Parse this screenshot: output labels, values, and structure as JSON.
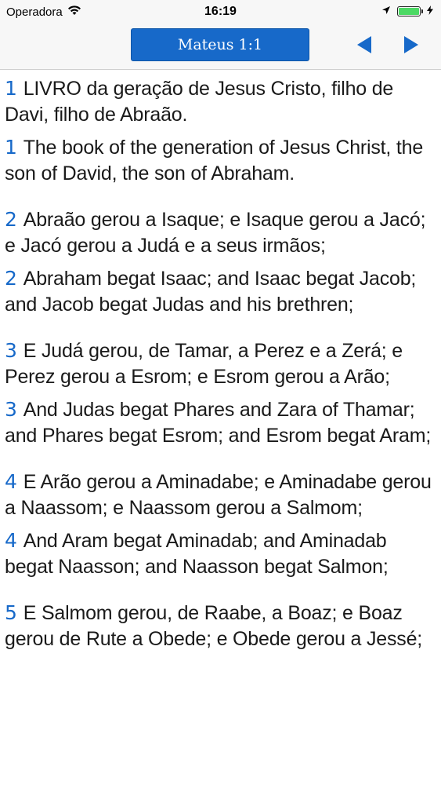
{
  "status_bar": {
    "carrier": "Operadora",
    "time": "16:19",
    "battery_level": 1.0,
    "battery_color": "#4cd964"
  },
  "nav": {
    "reference": "Mateus 1:1",
    "accent_color": "#1769c9",
    "prev_icon": "left-triangle-icon",
    "next_icon": "right-triangle-icon"
  },
  "verses": [
    {
      "pt_number": "1",
      "pt_text": "LIVRO da geração de Jesus Cristo, filho de Davi, filho de Abraão.",
      "en_number": "1",
      "en_text": "The book of the generation of Jesus Christ, the son of David, the son of Abraham."
    },
    {
      "pt_number": "2",
      "pt_text": "Abraão gerou a Isaque; e Isaque gerou a Jacó; e Jacó gerou a Judá e a seus irmãos;",
      "en_number": "2",
      "en_text": "Abraham begat Isaac; and Isaac begat Jacob; and Jacob begat Judas and his brethren;"
    },
    {
      "pt_number": "3",
      "pt_text": "E Judá gerou, de Tamar, a Perez e a Zerá; e Perez gerou a Esrom; e Esrom gerou a Arão;",
      "en_number": "3",
      "en_text": "And Judas begat Phares and Zara of Thamar; and Phares begat Esrom; and Esrom begat Aram;"
    },
    {
      "pt_number": "4",
      "pt_text": "E Arão gerou a Aminadabe; e Aminadabe gerou a Naassom; e Naassom gerou a Salmom;",
      "en_number": "4",
      "en_text": "And Aram begat Aminadab; and Aminadab begat Naasson; and Naasson begat Salmon;"
    },
    {
      "pt_number": "5",
      "pt_text": "E Salmom gerou, de Raabe, a Boaz; e Boaz gerou de Rute a Obede; e Obede gerou a Jessé;",
      "en_number": "",
      "en_text": ""
    }
  ]
}
